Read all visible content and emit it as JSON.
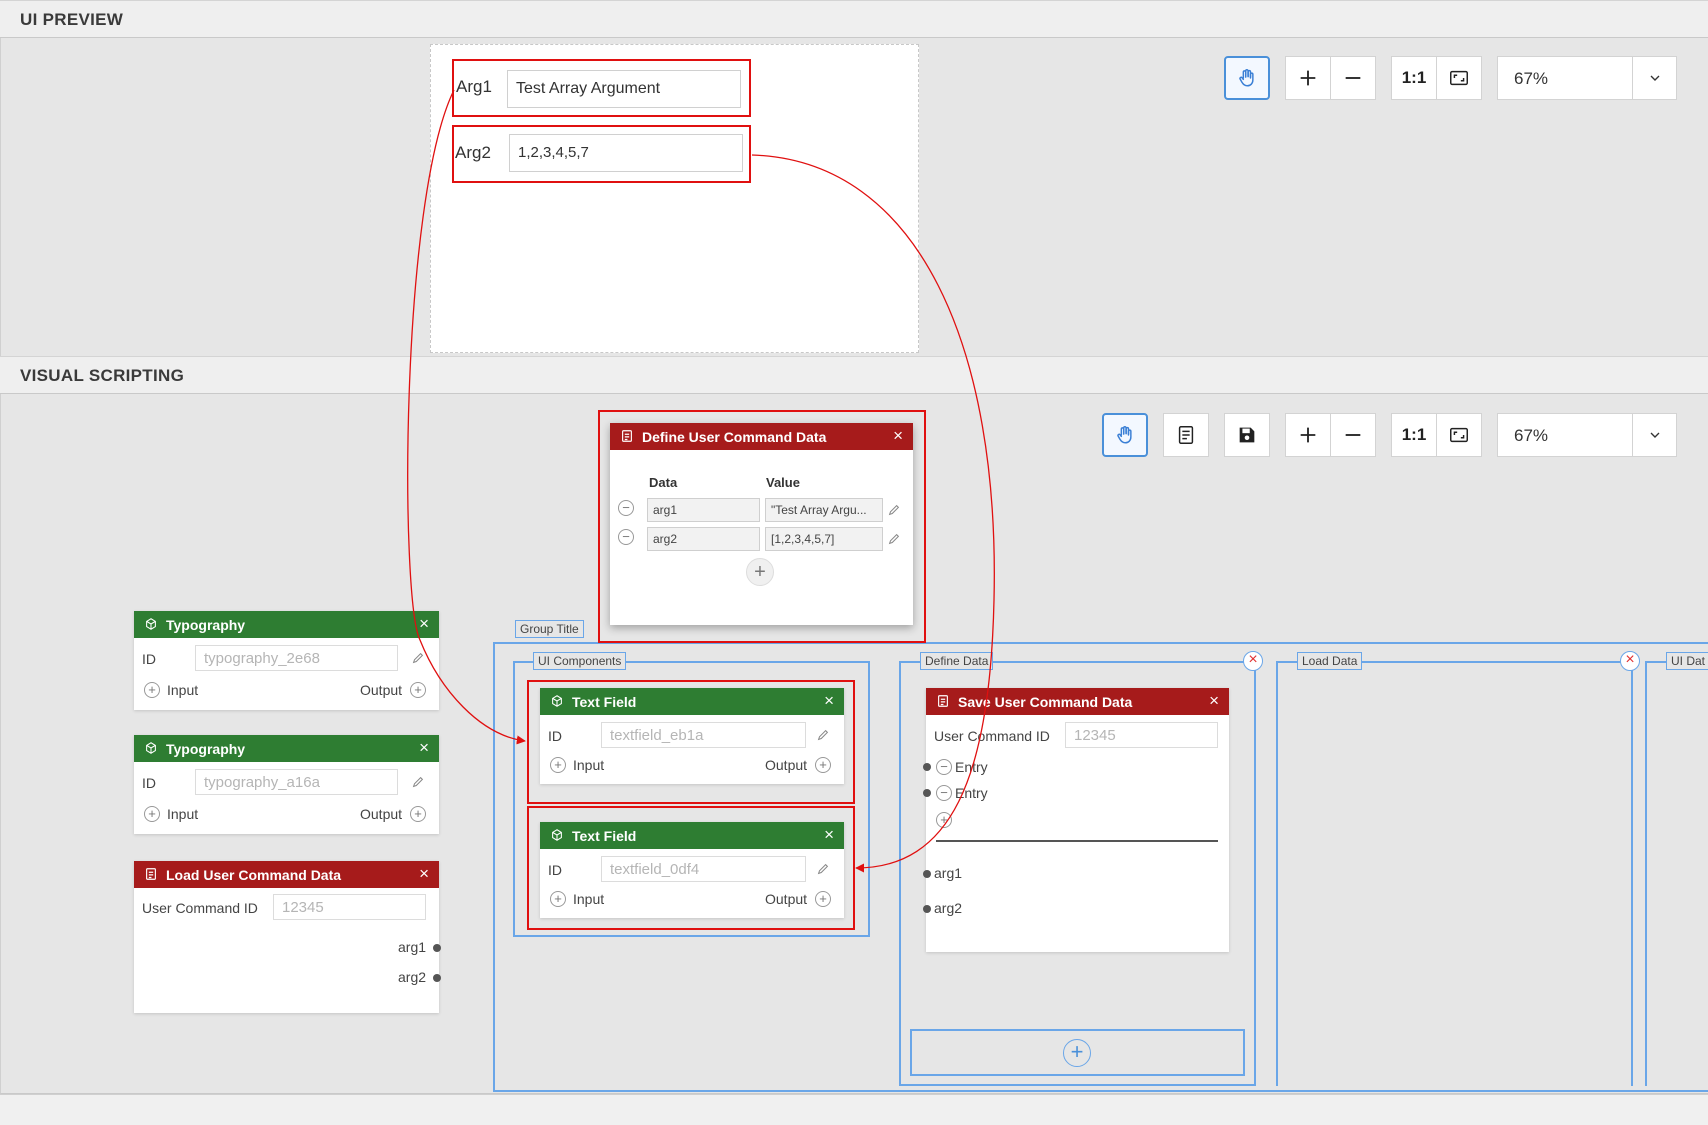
{
  "ui_preview": {
    "title": "UI PREVIEW",
    "zoom": "67%",
    "toolbar": {
      "one_to_one": "1:1"
    },
    "fields": [
      {
        "label": "Arg1",
        "value": "Test Array Argument"
      },
      {
        "label": "Arg2",
        "value": "1,2,3,4,5,7"
      }
    ]
  },
  "visual_scripting": {
    "title": "VISUAL SCRIPTING",
    "zoom": "67%",
    "toolbar": {
      "one_to_one": "1:1"
    },
    "define_node": {
      "title": "Define User Command Data",
      "col_data": "Data",
      "col_value": "Value",
      "rows": [
        {
          "data": "arg1",
          "value": "\"Test Array Argu..."
        },
        {
          "data": "arg2",
          "value": "[1,2,3,4,5,7]"
        }
      ]
    },
    "typography_nodes": [
      {
        "title": "Typography",
        "id_label": "ID",
        "id_value": "typography_2e68",
        "input": "Input",
        "output": "Output"
      },
      {
        "title": "Typography",
        "id_label": "ID",
        "id_value": "typography_a16a",
        "input": "Input",
        "output": "Output"
      }
    ],
    "load_node": {
      "title": "Load User Command Data",
      "id_label": "User Command ID",
      "id_value": "12345",
      "outputs": [
        "arg1",
        "arg2"
      ]
    },
    "groups": {
      "group_title": "Group Title",
      "ui_components": "UI Components",
      "define_data": "Define Data",
      "load_data": "Load Data",
      "ui_data": "UI Dat"
    },
    "textfield_nodes": [
      {
        "title": "Text Field",
        "id_label": "ID",
        "id_value": "textfield_eb1a",
        "input": "Input",
        "output": "Output"
      },
      {
        "title": "Text Field",
        "id_label": "ID",
        "id_value": "textfield_0df4",
        "input": "Input",
        "output": "Output"
      }
    ],
    "save_node": {
      "title": "Save User Command Data",
      "id_label": "User Command ID",
      "id_value": "12345",
      "entries": [
        "Entry",
        "Entry"
      ],
      "args": [
        "arg1",
        "arg2"
      ]
    }
  },
  "colors": {
    "green_header": "#2e7d32",
    "red_header": "#a61b1b",
    "highlight_red": "#e01010",
    "group_blue": "#6aa6e8",
    "active_blue": "#4a90d9"
  }
}
